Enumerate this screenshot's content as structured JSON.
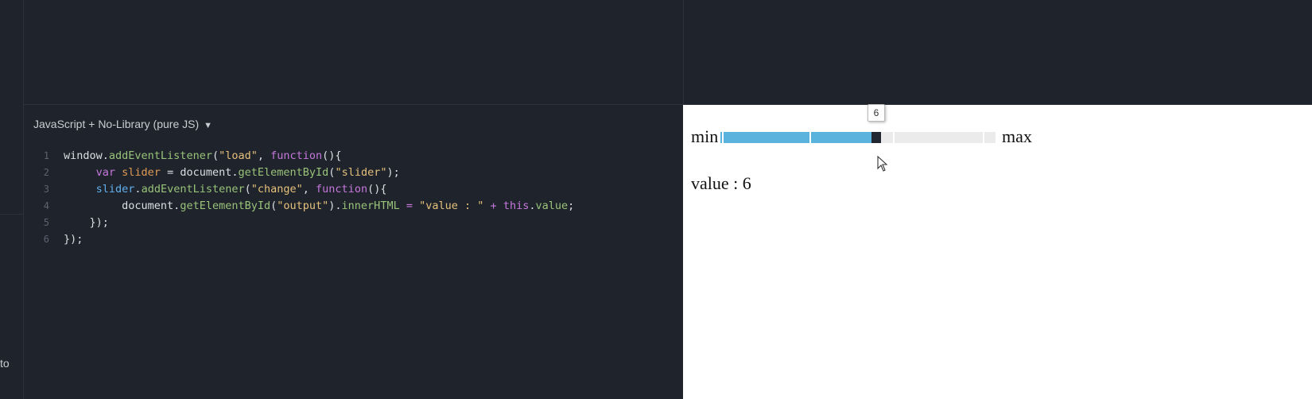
{
  "left_strip": {
    "fragment_text": "to"
  },
  "js_pane": {
    "language_label": "JavaScript + No-Library (pure JS)",
    "dropdown_arrow": "▼",
    "lines": [
      {
        "n": "1",
        "tokens": [
          {
            "t": "window.",
            "c": "pl"
          },
          {
            "t": "addEventListener",
            "c": "fn"
          },
          {
            "t": "(",
            "c": "pl"
          },
          {
            "t": "\"load\"",
            "c": "str"
          },
          {
            "t": ", ",
            "c": "pl"
          },
          {
            "t": "function",
            "c": "kw"
          },
          {
            "t": "(){",
            "c": "pl"
          }
        ]
      },
      {
        "n": "2",
        "tokens": [
          {
            "t": "     ",
            "c": "pl"
          },
          {
            "t": "var",
            "c": "kw"
          },
          {
            "t": " ",
            "c": "pl"
          },
          {
            "t": "slider",
            "c": "var"
          },
          {
            "t": " = document.",
            "c": "pl"
          },
          {
            "t": "getElementById",
            "c": "fn"
          },
          {
            "t": "(",
            "c": "pl"
          },
          {
            "t": "\"slider\"",
            "c": "str"
          },
          {
            "t": ");",
            "c": "pl"
          }
        ]
      },
      {
        "n": "3",
        "tokens": [
          {
            "t": "     ",
            "c": "pl"
          },
          {
            "t": "slider",
            "c": "obj"
          },
          {
            "t": ".",
            "c": "pl"
          },
          {
            "t": "addEventListener",
            "c": "fn"
          },
          {
            "t": "(",
            "c": "pl"
          },
          {
            "t": "\"change\"",
            "c": "str"
          },
          {
            "t": ", ",
            "c": "pl"
          },
          {
            "t": "function",
            "c": "kw"
          },
          {
            "t": "(){",
            "c": "pl"
          }
        ]
      },
      {
        "n": "4",
        "tokens": [
          {
            "t": "         document.",
            "c": "pl"
          },
          {
            "t": "getElementById",
            "c": "fn"
          },
          {
            "t": "(",
            "c": "pl"
          },
          {
            "t": "\"output\"",
            "c": "str"
          },
          {
            "t": ").",
            "c": "pl"
          },
          {
            "t": "innerHTML",
            "c": "fn"
          },
          {
            "t": " ",
            "c": "pl"
          },
          {
            "t": "=",
            "c": "op"
          },
          {
            "t": " ",
            "c": "pl"
          },
          {
            "t": "\"value : \"",
            "c": "str"
          },
          {
            "t": " ",
            "c": "pl"
          },
          {
            "t": "+",
            "c": "op"
          },
          {
            "t": " ",
            "c": "pl"
          },
          {
            "t": "this",
            "c": "kw"
          },
          {
            "t": ".",
            "c": "pl"
          },
          {
            "t": "value",
            "c": "fn"
          },
          {
            "t": ";",
            "c": "pl"
          }
        ]
      },
      {
        "n": "5",
        "tokens": [
          {
            "t": "    });",
            "c": "pl"
          }
        ]
      },
      {
        "n": "6",
        "tokens": [
          {
            "t": "});",
            "c": "pl"
          }
        ]
      }
    ]
  },
  "result": {
    "min_label": "min",
    "max_label": "max",
    "slider_value": 6,
    "slider_min": 0,
    "slider_max": 10,
    "tooltip": "6",
    "output_text": "value : 6"
  },
  "colors": {
    "editor_bg": "#1f232b",
    "slider_fill": "#5ab3dd",
    "slider_track": "#ebebeb",
    "slider_handle": "#222831"
  },
  "icons": {
    "dropdown": "triangle-down",
    "cursor": "mouse-pointer"
  }
}
